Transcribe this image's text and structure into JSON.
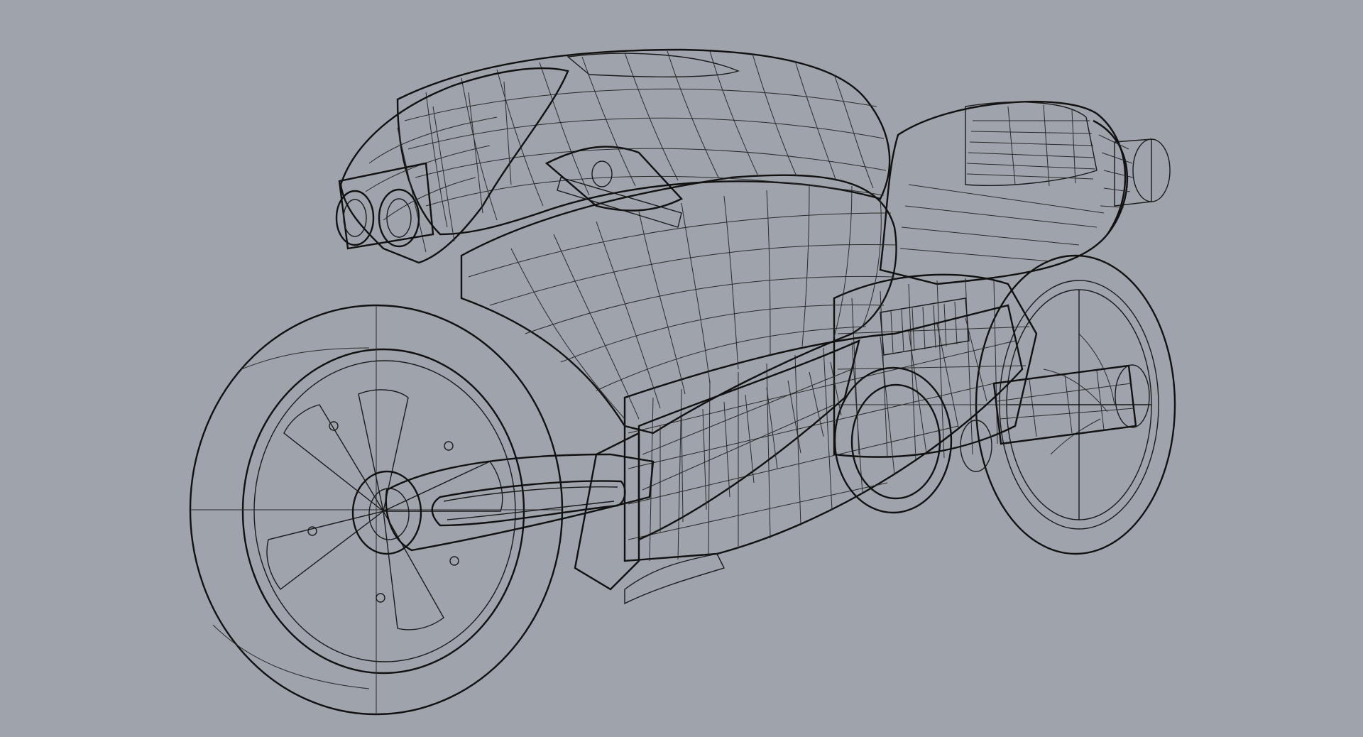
{
  "viewport": {
    "background_color": "#9ea3ac",
    "display_mode": "shaded-with-isocurves",
    "model_subject": "motorcycle-concept",
    "surface_colors": {
      "light": "#d4d5d7",
      "mid": "#b1b3b6",
      "dark": "#7e8083",
      "edge": "#1a1a1a"
    }
  }
}
